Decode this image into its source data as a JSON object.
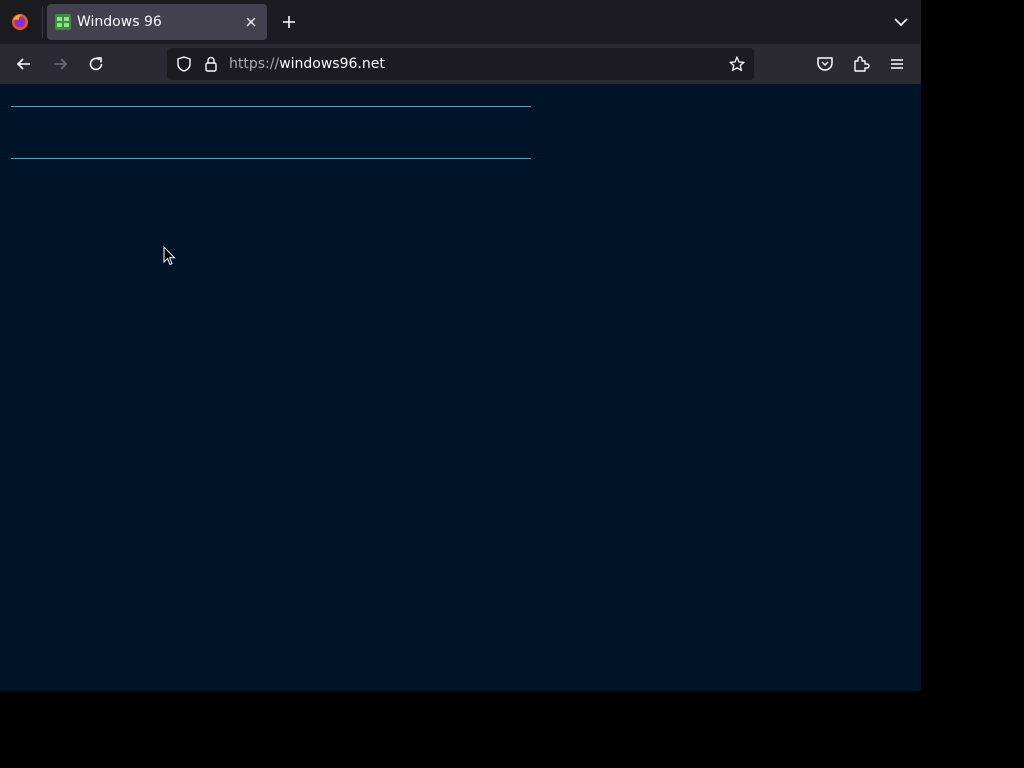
{
  "browser": {
    "tab": {
      "title": "Windows 96"
    },
    "url": {
      "scheme": "https://",
      "host": "windows96.net"
    }
  },
  "icons": {
    "app_logo": "firefox-icon",
    "favicon": "windows96-favicon",
    "tab_close": "close-icon",
    "new_tab": "plus-icon",
    "tab_list": "chevron-down-icon",
    "back": "back-arrow-icon",
    "forward": "forward-arrow-icon",
    "reload": "reload-icon",
    "tracking_protection": "shield-icon",
    "secure": "lock-icon",
    "bookmark": "star-icon",
    "pocket": "pocket-icon",
    "extensions": "puzzle-icon",
    "menu": "hamburger-menu-icon"
  },
  "colors": {
    "page_background": "#001429",
    "accent_line": "#2bb3c9",
    "toolbar": "#2b2a33",
    "tabstrip": "#1c1b22"
  }
}
